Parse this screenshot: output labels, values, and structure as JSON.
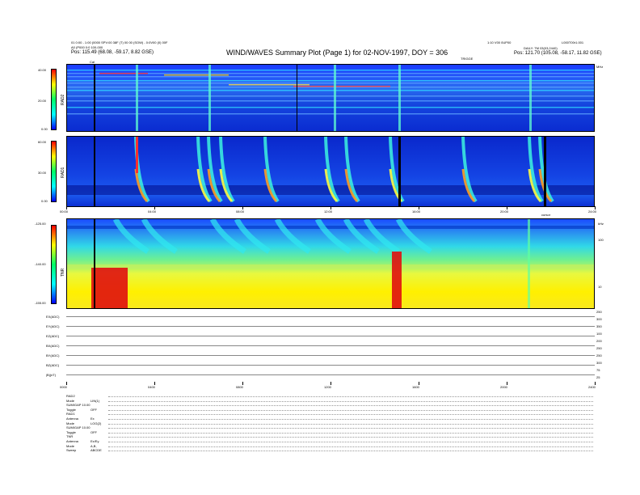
{
  "header": {
    "title": "WIND/WAVES Summary Plot (Page 1) for 02-NOV-1997, DOY = 306",
    "top_left_line1": "01 0:00 - 1:00 (0000 SPV:00 38F (T) 00 00 (SOW) - 0:0V00 (0) 00F",
    "top_left_line2": "A0 (P000 0:0 100-000",
    "pos_left": "Pos: 115.49 (68.08, -59.17, 8.82 GSE)",
    "top_right_line1": "1:10 V00 0UP00",
    "top_right_line2": "L000T00r1.001",
    "daily_text": "DAILY: TM 03(03,2440)",
    "pos_right": "Pos: 121.70 (105.08, -58.17, 11.82 GSE)",
    "marker_calib": "Cal",
    "trigger_label": "TRIGGE",
    "mhz_label": "MHz",
    "cursor_label": "cursor",
    "khz_label": "kHz"
  },
  "panels": {
    "rad2": {
      "label": "RAD2",
      "ticks": [
        "40.00",
        "20.00",
        "0.00"
      ]
    },
    "rad1": {
      "label": "RAD1",
      "ticks": [
        "60.00",
        "30.00",
        "0.00"
      ]
    },
    "tnr": {
      "label": "TNR",
      "ticks": [
        "-125.00",
        "-140.00",
        "-155.00"
      ],
      "right_ticks": [
        "100",
        "10"
      ]
    }
  },
  "time_axis": [
    "00:00",
    "04:00",
    "08:00",
    "12:00",
    "16:00",
    "20:00",
    "24:00"
  ],
  "time_axis_small": [
    "0000",
    "0400",
    "0800",
    "1200",
    "1600",
    "2000",
    "2400"
  ],
  "traces": [
    {
      "label": "EX(ADC)",
      "right": "300"
    },
    {
      "label": "EY(ADC)",
      "right": "300"
    },
    {
      "label": "EZ(ADC)",
      "right": "300"
    },
    {
      "label": "BX(ADC)",
      "right": "300"
    },
    {
      "label": "BY(ADC)",
      "right": "300"
    },
    {
      "label": "BZ(ADC)",
      "right": "300"
    },
    {
      "label": "|B|(nT)",
      "right": "75"
    }
  ],
  "trace_right_small": [
    "250",
    "300",
    "350",
    "100",
    "200",
    "250",
    "250",
    "300",
    "75",
    "25"
  ],
  "status": [
    {
      "k": "RAD2",
      "v": ""
    },
    {
      "k": "Mode",
      "v": "LIN(1)"
    },
    {
      "k": "SUMIGAP 10.00",
      "v": ""
    },
    {
      "k": "Toggle",
      "v": "OFF"
    },
    {
      "k": "RAD1",
      "v": ""
    },
    {
      "k": "Antenna",
      "v": "Ex"
    },
    {
      "k": "Mode",
      "v": "LOG(2)"
    },
    {
      "k": "SUMIGAP 10.00",
      "v": ""
    },
    {
      "k": "Toggle",
      "v": "OFF"
    },
    {
      "k": "TNR",
      "v": ""
    },
    {
      "k": "Antenna",
      "v": "Ex/Ey"
    },
    {
      "k": "Mode",
      "v": "A,B,"
    },
    {
      "k": "Sweep",
      "v": "ABCDE"
    }
  ],
  "colors": {
    "bg": "#0022cc",
    "cyan": "#00ffff",
    "yellow": "#ffff00",
    "red": "#ff0000",
    "green": "#00dd66"
  }
}
